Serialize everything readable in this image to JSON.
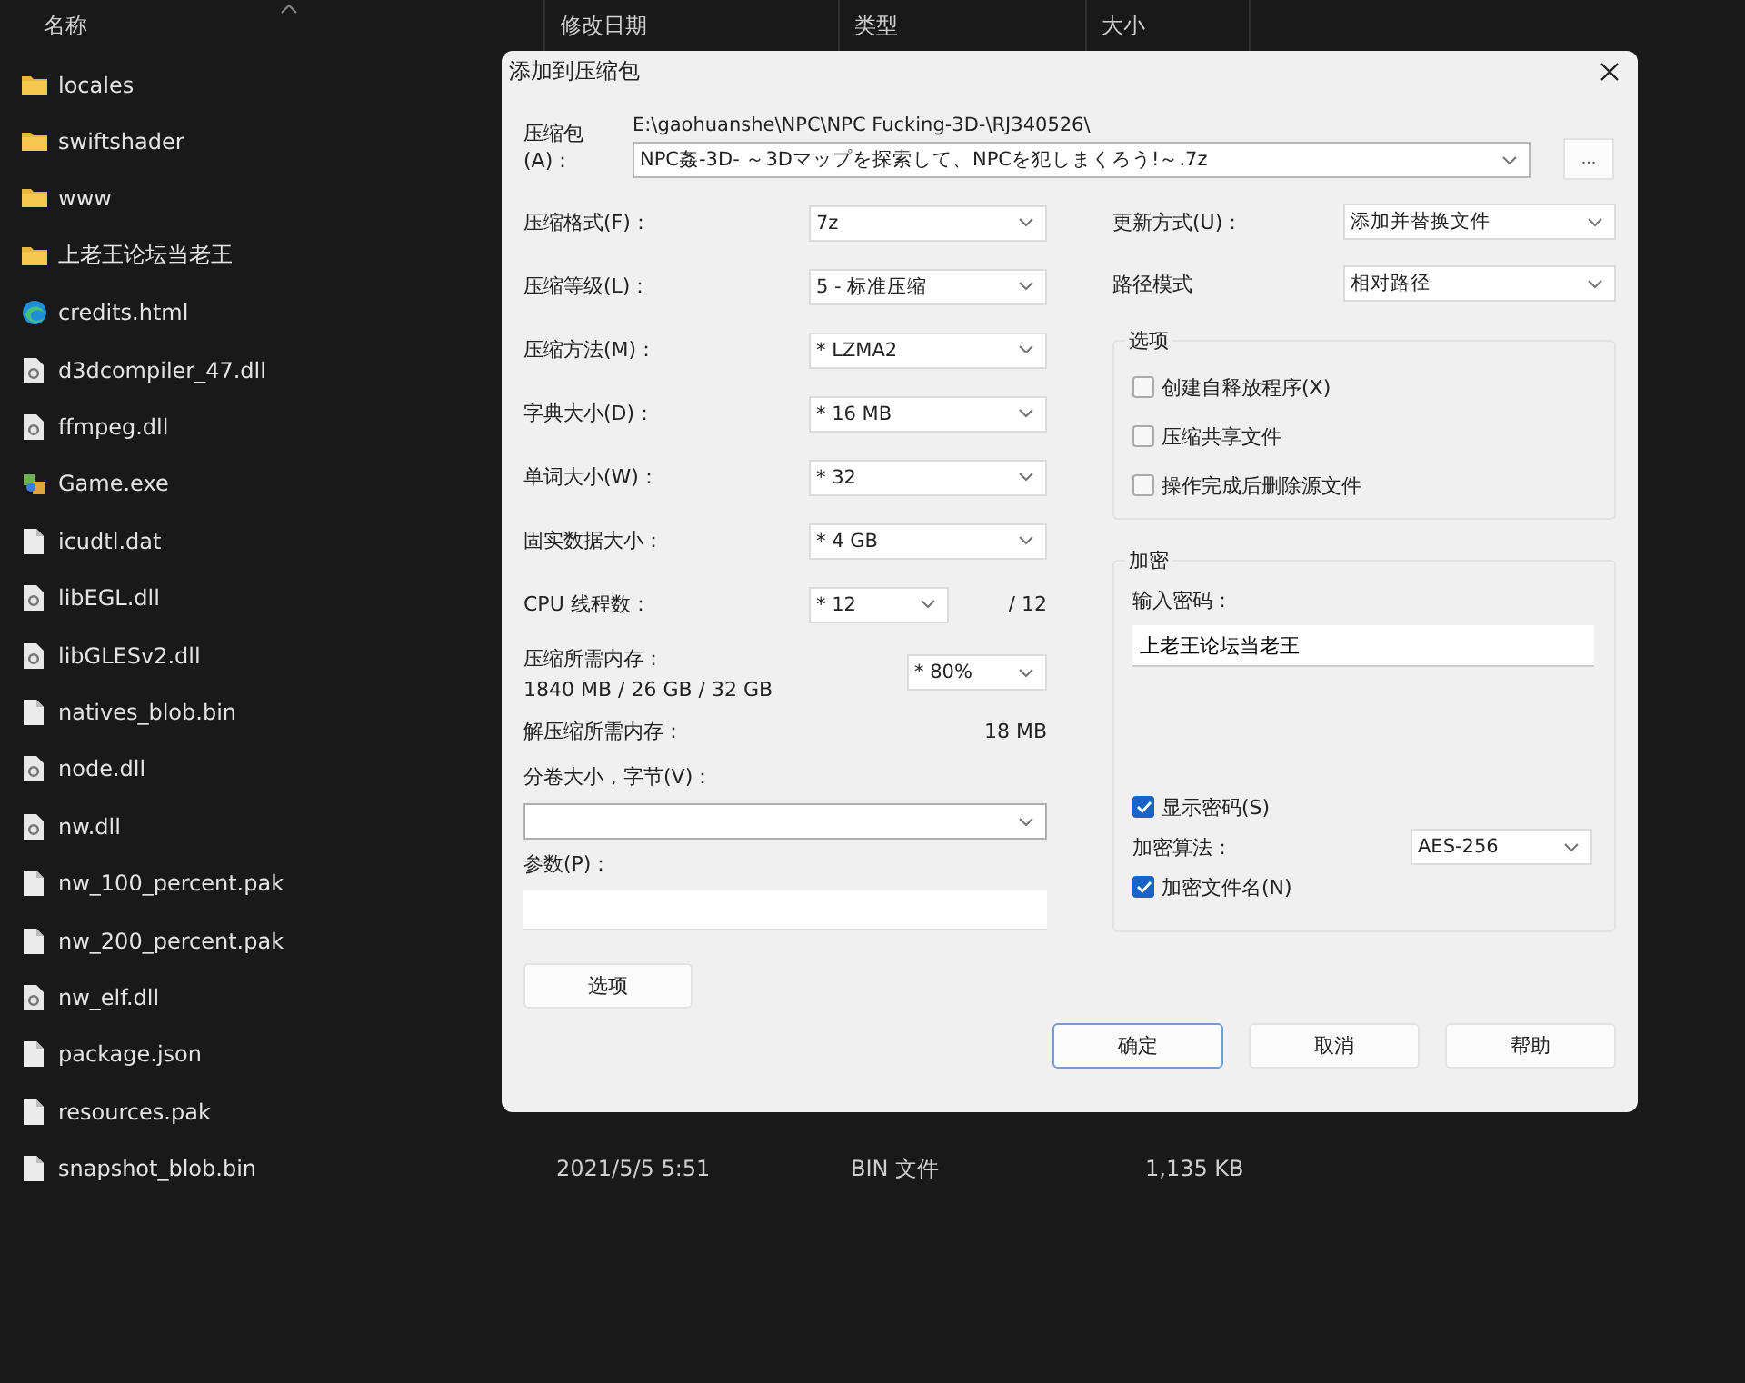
{
  "explorer": {
    "columns": [
      {
        "label": "名称",
        "sorted": true
      },
      {
        "label": "修改日期",
        "sorted": false
      },
      {
        "label": "类型",
        "sorted": false
      },
      {
        "label": "大小",
        "sorted": false
      }
    ],
    "files": [
      {
        "name": "locales",
        "kind": "folder"
      },
      {
        "name": "swiftshader",
        "kind": "folder"
      },
      {
        "name": "www",
        "kind": "folder"
      },
      {
        "name": "上老王论坛当老王",
        "kind": "folder"
      },
      {
        "name": "credits.html",
        "kind": "web"
      },
      {
        "name": "d3dcompiler_47.dll",
        "kind": "library"
      },
      {
        "name": "ffmpeg.dll",
        "kind": "library"
      },
      {
        "name": "Game.exe",
        "kind": "app"
      },
      {
        "name": "icudtl.dat",
        "kind": "file"
      },
      {
        "name": "libEGL.dll",
        "kind": "library"
      },
      {
        "name": "libGLESv2.dll",
        "kind": "library"
      },
      {
        "name": "natives_blob.bin",
        "kind": "file"
      },
      {
        "name": "node.dll",
        "kind": "library"
      },
      {
        "name": "nw.dll",
        "kind": "library"
      },
      {
        "name": "nw_100_percent.pak",
        "kind": "file"
      },
      {
        "name": "nw_200_percent.pak",
        "kind": "file"
      },
      {
        "name": "nw_elf.dll",
        "kind": "library"
      },
      {
        "name": "package.json",
        "kind": "file"
      },
      {
        "name": "resources.pak",
        "kind": "file"
      },
      {
        "name": "snapshot_blob.bin",
        "kind": "file",
        "date": "2021/5/5 5:51",
        "type": "BIN 文件",
        "size": "1,135 KB"
      }
    ]
  },
  "dialog": {
    "title": "添加到压缩包",
    "archive": {
      "label": "压缩包(A)：",
      "path": "E:\\gaohuanshe\\NPC\\NPC Fucking-3D-\\RJ340526\\",
      "value": "NPC姦-3D- ～3Dマップを探索して、NPCを犯しまくろう!～.7z",
      "browse": "..."
    },
    "left_rows": [
      {
        "kind": "combo",
        "label": "压缩格式(F)：",
        "value": "7z"
      },
      {
        "kind": "combo",
        "label": "压缩等级(L)：",
        "value": "5 - 标准压缩"
      },
      {
        "kind": "combo",
        "label": "压缩方法(M)：",
        "value": "* LZMA2"
      },
      {
        "kind": "combo",
        "label": "字典大小(D)：",
        "value": "* 16 MB"
      },
      {
        "kind": "combo",
        "label": "单词大小(W)：",
        "value": "* 32"
      },
      {
        "kind": "combo",
        "label": "固实数据大小：",
        "value": "* 4 GB"
      },
      {
        "kind": "short_combo",
        "label": "CPU 线程数：",
        "value": "* 12",
        "suffix": "/ 12"
      },
      {
        "kind": "memory",
        "label": "压缩所需内存：",
        "detail": "1840 MB / 26 GB / 32 GB",
        "value": "* 80%"
      },
      {
        "kind": "readout",
        "label": "解压缩所需内存：",
        "value": "18 MB"
      },
      {
        "kind": "wide_combo",
        "label": "分卷大小，字节(V)："
      },
      {
        "kind": "wide_text",
        "label": "参数(P)："
      }
    ],
    "options_button": "选项",
    "right_rows": [
      {
        "label": "更新方式(U)：",
        "value": "添加并替换文件"
      },
      {
        "label": "路径模式",
        "value": "相对路径"
      }
    ],
    "options_group": {
      "title": "选项",
      "checkboxes": [
        {
          "label": "创建自释放程序(X)",
          "checked": false
        },
        {
          "label": "压缩共享文件",
          "checked": false
        },
        {
          "label": "操作完成后删除源文件",
          "checked": false
        }
      ]
    },
    "encryption": {
      "title": "加密",
      "password_label": "输入密码：",
      "password": "上老王论坛当老王",
      "show_password": {
        "label": "显示密码(S)",
        "checked": true
      },
      "method_label": "加密算法：",
      "method": "AES-256",
      "encrypt_names": {
        "label": "加密文件名(N)",
        "checked": true
      }
    },
    "buttons": [
      {
        "label": "确定",
        "default": true
      },
      {
        "label": "取消",
        "default": false
      },
      {
        "label": "帮助",
        "default": false
      }
    ]
  }
}
